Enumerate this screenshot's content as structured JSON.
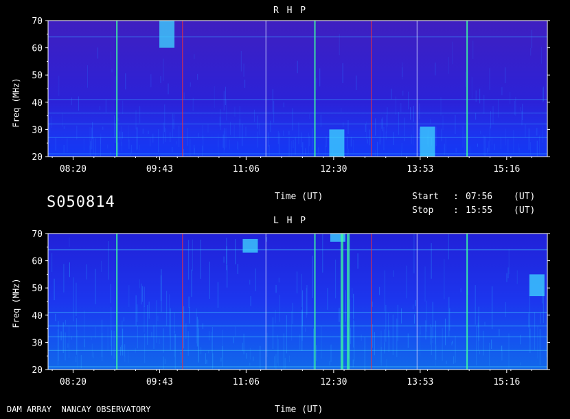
{
  "station_id": "S050814",
  "footer": "DAM ARRAY  NANCAY OBSERVATORY",
  "start_label": "Start",
  "stop_label": "Stop",
  "start_time": "07:56",
  "stop_time": "15:55",
  "ut_label": "(UT)",
  "colors": {
    "background": "#000000",
    "spectrum_base": "#2a1fe0",
    "burst": "#3fd8ff",
    "marker_green": "#3dffa0",
    "marker_red": "#ff3030"
  },
  "chart_data": [
    {
      "type": "heatmap",
      "title": "R H P",
      "xlabel": "Time (UT)",
      "ylabel": "Freq (MHz)",
      "x_ticks": [
        "08:20",
        "09:43",
        "11:06",
        "12:30",
        "13:53",
        "15:16"
      ],
      "y_ticks": [
        "20",
        "30",
        "40",
        "50",
        "60",
        "70"
      ],
      "ylim": [
        20,
        70
      ],
      "time_range": [
        "07:56",
        "15:55"
      ],
      "vertical_markers": [
        "09:02",
        "10:05",
        "11:25",
        "12:12",
        "13:06",
        "13:50",
        "14:38"
      ],
      "bright_regions": [
        {
          "time": "09:50",
          "freq_range": [
            60,
            70
          ]
        },
        {
          "time": "12:33",
          "freq_range": [
            20,
            30
          ]
        },
        {
          "time": "14:00",
          "freq_range": [
            20,
            31
          ]
        }
      ]
    },
    {
      "type": "heatmap",
      "title": "L H P",
      "xlabel": "Time (UT)",
      "ylabel": "Freq (MHz)",
      "x_ticks": [
        "08:20",
        "09:43",
        "11:06",
        "12:30",
        "13:53",
        "15:16"
      ],
      "y_ticks": [
        "20",
        "30",
        "40",
        "50",
        "60",
        "70"
      ],
      "ylim": [
        20,
        70
      ],
      "time_range": [
        "07:56",
        "15:55"
      ],
      "vertical_markers": [
        "09:02",
        "10:05",
        "11:25",
        "12:12",
        "13:06",
        "13:50",
        "14:38"
      ],
      "bright_regions": [
        {
          "time": "11:10",
          "freq_range": [
            63,
            68
          ]
        },
        {
          "time": "12:34",
          "freq_range": [
            67,
            70
          ]
        },
        {
          "time": "12:38",
          "freq_range": [
            20,
            70
          ]
        },
        {
          "time": "12:44",
          "freq_range": [
            20,
            70
          ]
        },
        {
          "time": "15:45",
          "freq_range": [
            47,
            55
          ]
        }
      ]
    }
  ]
}
